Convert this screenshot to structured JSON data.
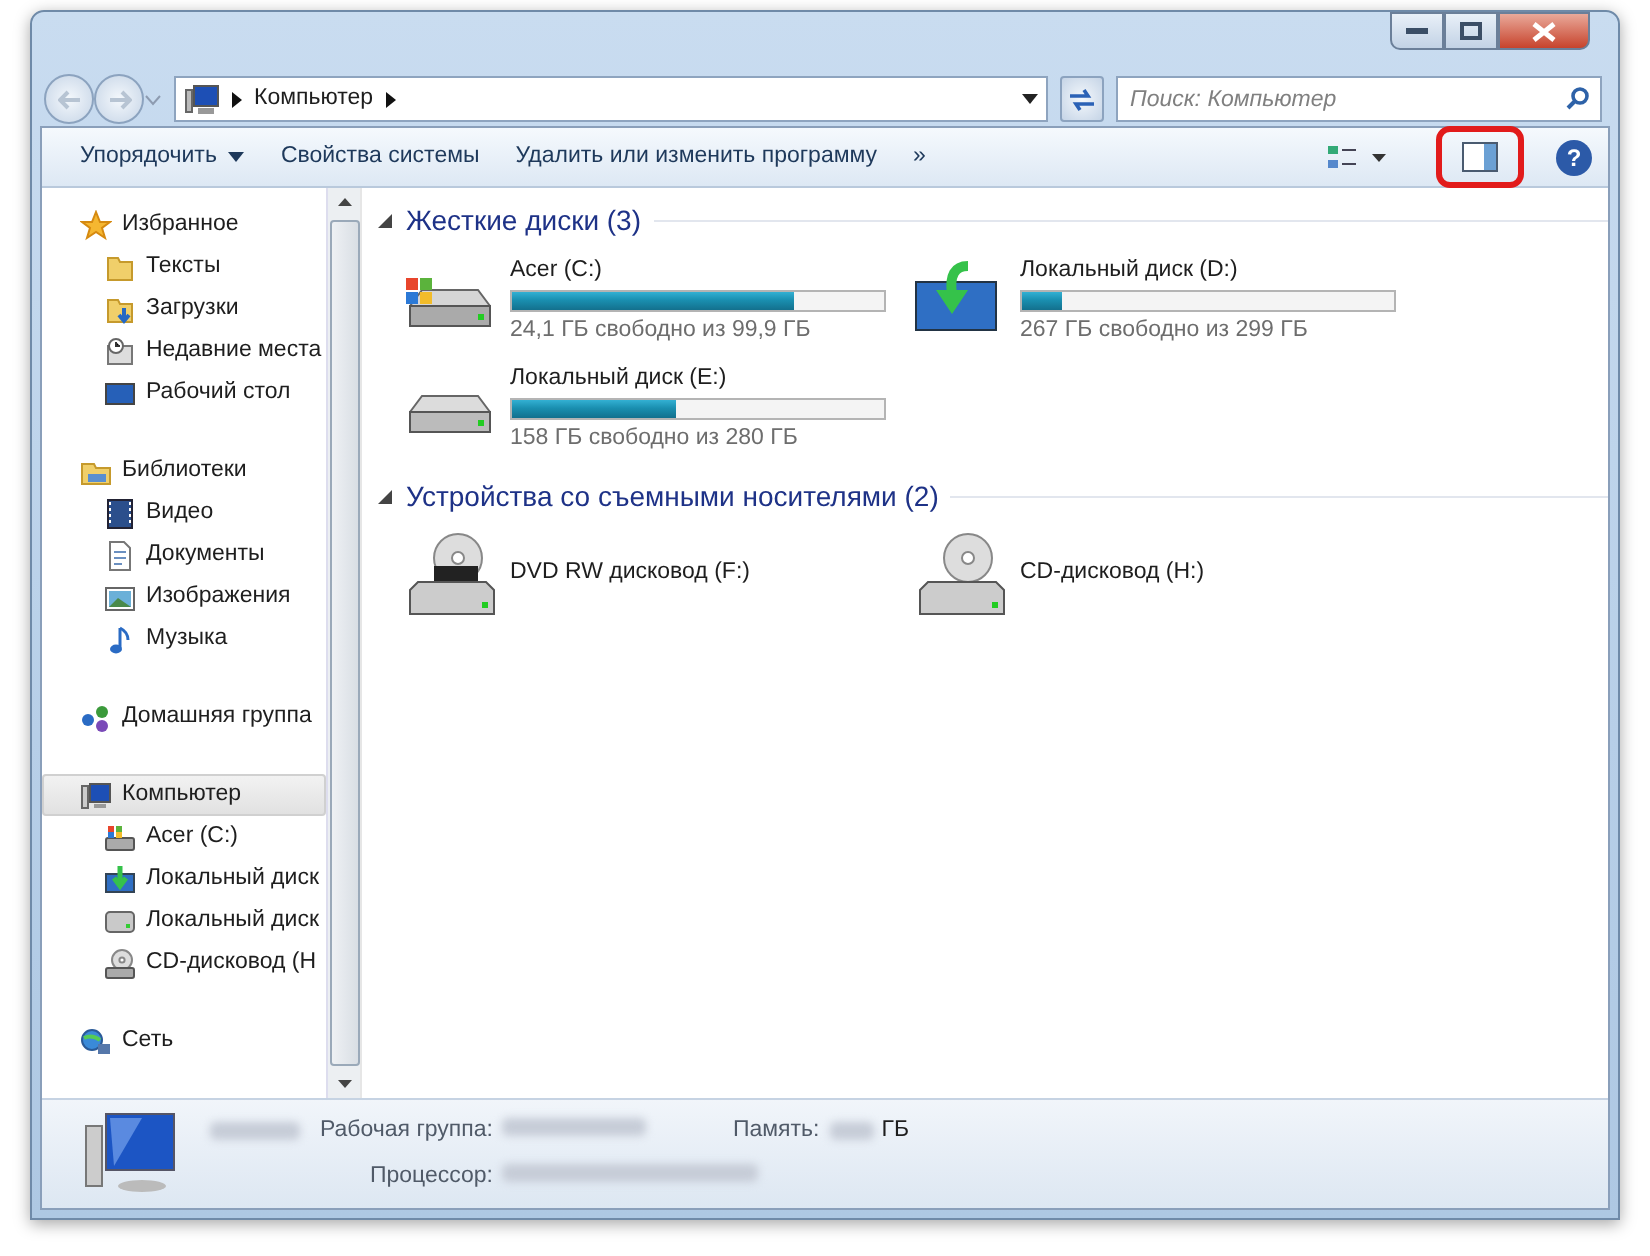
{
  "address_bar": {
    "path": [
      "Компьютер"
    ]
  },
  "search": {
    "placeholder": "Поиск: Компьютер"
  },
  "toolbar": {
    "buttons": [
      {
        "label": "Упорядочить",
        "dropdown": true
      },
      {
        "label": "Свойства системы",
        "dropdown": false
      },
      {
        "label": "Удалить или изменить программу",
        "dropdown": false
      },
      {
        "label": "»",
        "dropdown": false
      }
    ],
    "help_label": "?"
  },
  "sidebar": {
    "groups": [
      {
        "label": "Избранное",
        "kind": "star",
        "selected": false,
        "children": [
          {
            "label": "Тексты",
            "kind": "folder",
            "selected": false
          },
          {
            "label": "Загрузки",
            "kind": "downloads",
            "selected": false
          },
          {
            "label": "Недавние места",
            "kind": "recent",
            "selected": false
          },
          {
            "label": "Рабочий стол",
            "kind": "desktop",
            "selected": false
          }
        ]
      },
      {
        "label": "Библиотеки",
        "kind": "library",
        "selected": false,
        "children": [
          {
            "label": "Видео",
            "kind": "video",
            "selected": false
          },
          {
            "label": "Документы",
            "kind": "document",
            "selected": false
          },
          {
            "label": "Изображения",
            "kind": "picture",
            "selected": false
          },
          {
            "label": "Музыка",
            "kind": "music",
            "selected": false
          }
        ]
      },
      {
        "label": "Домашняя группа",
        "kind": "homegroup",
        "selected": false
      },
      {
        "label": "Компьютер",
        "kind": "computer",
        "selected": true,
        "children": [
          {
            "label": "Acer (C:)",
            "kind": "system",
            "selected": false
          },
          {
            "label": "Локальный диск",
            "kind": "download",
            "selected": false
          },
          {
            "label": "Локальный диск",
            "kind": "hdd",
            "selected": false
          },
          {
            "label": "CD-дисковод (H",
            "kind": "cd",
            "selected": false
          }
        ]
      },
      {
        "label": "Сеть",
        "kind": "network",
        "selected": false
      }
    ]
  },
  "sections": [
    {
      "title": "Жесткие диски (3)",
      "expanded": true,
      "items": [
        {
          "name": "Acer (C:)",
          "kind": "system",
          "level": 0.76,
          "reading": "24,1 ГБ свободно из 99,9 ГБ"
        },
        {
          "name": "Локальный диск (D:)",
          "kind": "download",
          "level": 0.11,
          "reading": "267 ГБ свободно из 299 ГБ"
        },
        {
          "name": "Локальный диск (E:)",
          "kind": "hdd",
          "level": 0.44,
          "reading": "158 ГБ свободно из 280 ГБ"
        }
      ]
    },
    {
      "title": "Устройства со съемными носителями (2)",
      "expanded": true,
      "items": [
        {
          "name": "DVD RW дисковод (F:)",
          "kind": "dvd"
        },
        {
          "name": "CD-дисковод (H:)",
          "kind": "cd"
        }
      ]
    }
  ],
  "details": {
    "workgroup_label": "Рабочая группа:",
    "memory_label": "Память:",
    "memory_unit": "ГБ",
    "processor_label": "Процессор:"
  }
}
